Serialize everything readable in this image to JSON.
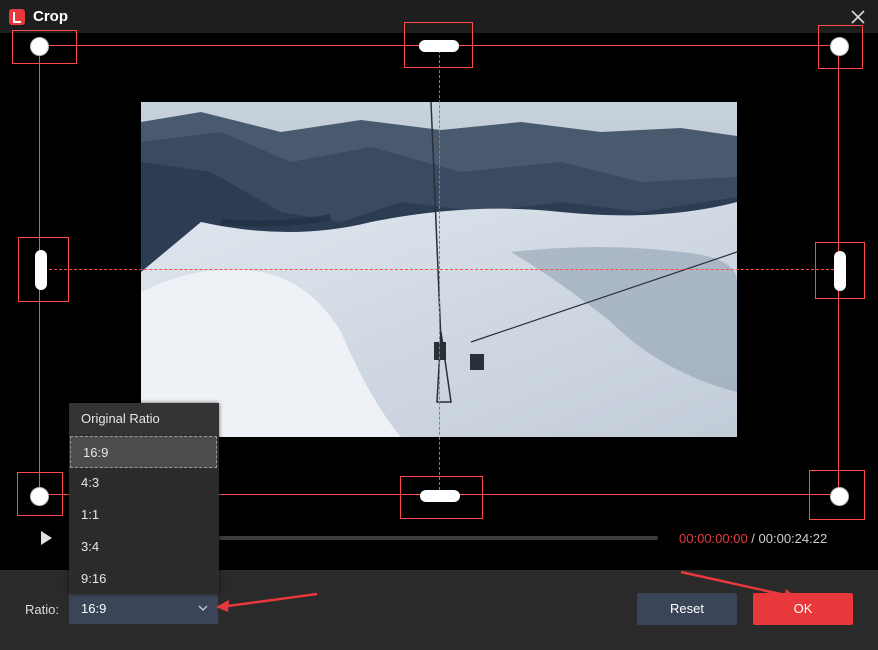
{
  "window": {
    "title": "Crop"
  },
  "player": {
    "current_time": "00:00:00:00",
    "separator": " / ",
    "total_time": "00:00:24:22"
  },
  "ratio": {
    "label": "Ratio:",
    "selected": "16:9",
    "options": [
      "Original Ratio",
      "16:9",
      "4:3",
      "1:1",
      "3:4",
      "9:16"
    ]
  },
  "buttons": {
    "reset": "Reset",
    "ok": "OK"
  },
  "colors": {
    "accent": "#e8383c",
    "crop_line": "#ff4b4b",
    "button_secondary": "#3a4658"
  }
}
